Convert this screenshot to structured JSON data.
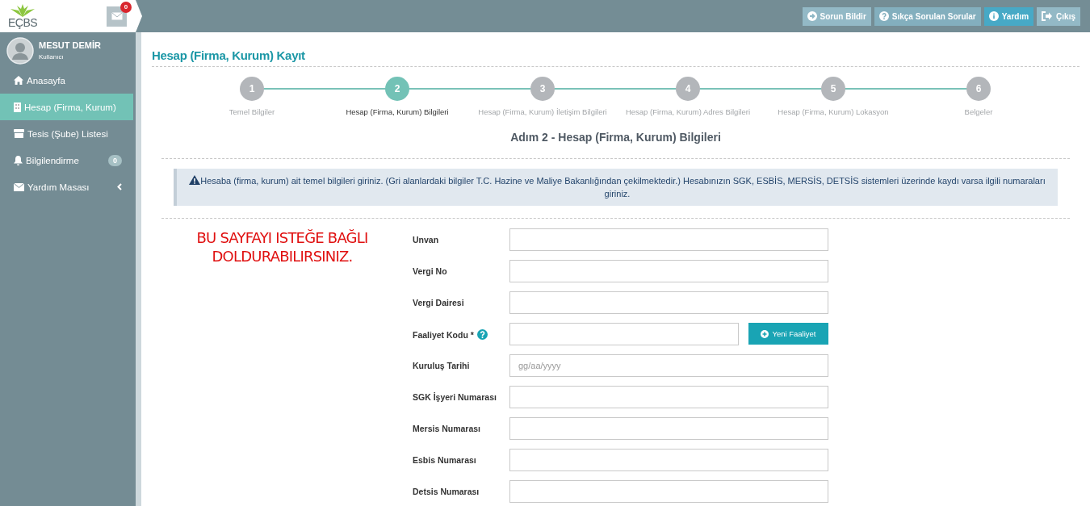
{
  "logo": "EÇBS",
  "mail_badge": "0",
  "header_buttons": [
    {
      "label": "Sorun Bildir",
      "kind": "report"
    },
    {
      "label": "Sıkça Sorulan Sorular",
      "kind": "faq"
    },
    {
      "label": "Yardım",
      "kind": "help"
    },
    {
      "label": "Çıkış",
      "kind": "logout"
    }
  ],
  "user": {
    "name": "MESUT DEMİR",
    "role": "Kullanıcı"
  },
  "sidebar": {
    "items": [
      {
        "label": "Anasayfa",
        "selected": false
      },
      {
        "label": "Hesap (Firma, Kurum)",
        "selected": true
      },
      {
        "label": "Tesis (Şube) Listesi",
        "selected": false
      },
      {
        "label": "Bilgilendirme",
        "selected": false,
        "badge": "0"
      },
      {
        "label": "Yardım Masası",
        "selected": false,
        "submenu": true
      }
    ]
  },
  "page_title": "Hesap (Firma, Kurum) Kayıt",
  "steps": [
    {
      "number": "1",
      "label": "Temel Bilgiler",
      "selected": false
    },
    {
      "number": "2",
      "label": "Hesap (Firma, Kurum) Bilgileri",
      "selected": true
    },
    {
      "number": "3",
      "label": "Hesap (Firma, Kurum) İletişim Bilgileri",
      "selected": false
    },
    {
      "number": "4",
      "label": "Hesap (Firma, Kurum) Adres Bilgileri",
      "selected": false
    },
    {
      "number": "5",
      "label": "Hesap (Firma, Kurum) Lokasyon",
      "selected": false
    },
    {
      "number": "6",
      "label": "Belgeler",
      "selected": false
    }
  ],
  "step_heading": "Adım 2 - Hesap (Firma, Kurum) Bilgileri",
  "alert": "Hesaba (firma, kurum) ait temel bilgileri giriniz. (Gri alanlardaki bilgiler T.C. Hazine ve Maliye Bakanlığından çekilmektedir.) Hesabınızın SGK, ESBİS, MERSİS, DETSİS sistemleri üzerinde kaydı varsa ilgili numaraları giriniz.",
  "annotation": [
    "BU SAYFAYI ISTEĞE BAĞLI",
    "DOLDURABILIRSINIZ."
  ],
  "fields": [
    {
      "label": "Unvan"
    },
    {
      "label": "Vergi No"
    },
    {
      "label": "Vergi Dairesi"
    },
    {
      "label": "Faaliyet Kodu *",
      "help": true,
      "button": "Yeni Faaliyet"
    },
    {
      "label": "Kuruluş Tarihi",
      "placeholder": "gg/aa/yyyy"
    },
    {
      "label": "SGK İşyeri Numarası"
    },
    {
      "label": "Mersis Numarası"
    },
    {
      "label": "Esbis Numarası"
    },
    {
      "label": "Detsis Numarası"
    }
  ]
}
